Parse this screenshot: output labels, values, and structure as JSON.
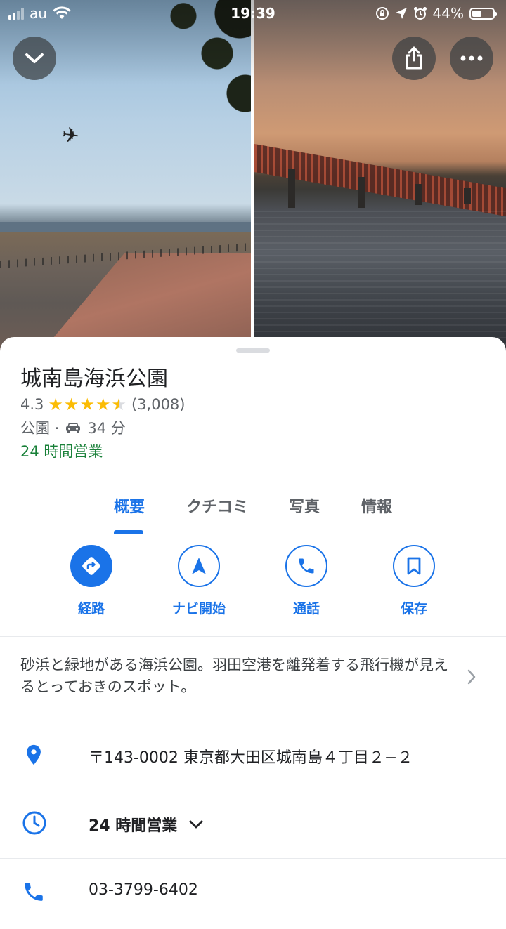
{
  "status_bar": {
    "carrier": "au",
    "time": "19:39",
    "battery": "44%"
  },
  "place": {
    "name": "城南島海浜公園",
    "rating": "4.3",
    "stars": 4.3,
    "review_count": "(3,008)",
    "category": "公園 ·",
    "drive_time": "34 分",
    "open_status": "24 時間営業"
  },
  "tabs": [
    {
      "label": "概要",
      "active": true
    },
    {
      "label": "クチコミ",
      "active": false
    },
    {
      "label": "写真",
      "active": false
    },
    {
      "label": "情報",
      "active": false
    }
  ],
  "actions": [
    {
      "label": "経路",
      "icon": "directions-icon"
    },
    {
      "label": "ナビ開始",
      "icon": "navigation-arrow-icon"
    },
    {
      "label": "通話",
      "icon": "phone-icon"
    },
    {
      "label": "保存",
      "icon": "bookmark-icon"
    }
  ],
  "description": "砂浜と緑地がある海浜公園。羽田空港を離発着する飛行機が見えるとっておきのスポット。",
  "info": {
    "address": "〒143-0002 東京都大田区城南島４丁目２−２",
    "hours": "24 時間営業",
    "phone": "03-3799-6402"
  },
  "colors": {
    "accent": "#1a73e8",
    "open_green": "#188038",
    "star": "#fbbc04"
  }
}
